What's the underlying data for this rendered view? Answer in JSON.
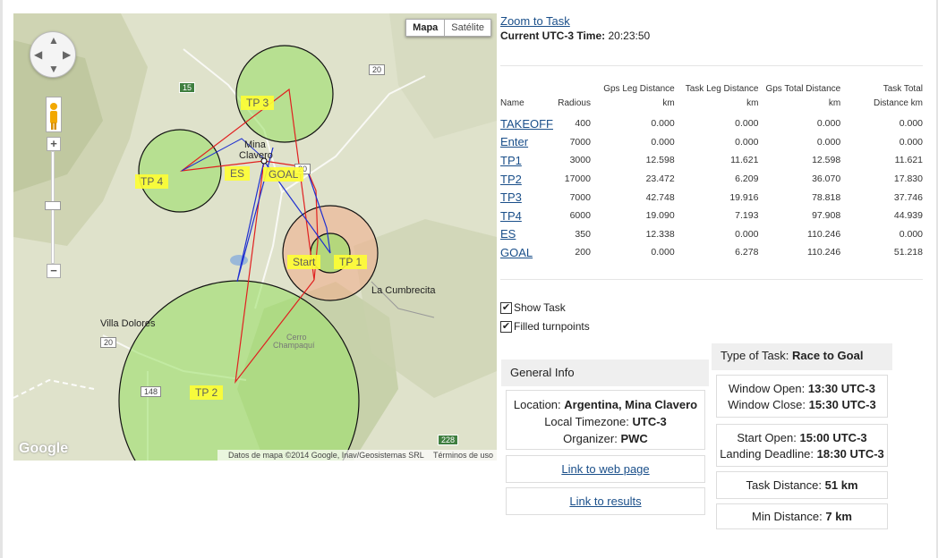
{
  "map": {
    "maptype": {
      "map_label": "Mapa",
      "satellite_label": "Satélite"
    },
    "attribution": "Datos de mapa ©2014 Google, Inav/Geosistemas SRL",
    "terms": "Términos de uso",
    "logo": "Google",
    "places": {
      "mina": "Mina",
      "clavero": "Clavero",
      "cumbrecita": "La Cumbrecita",
      "villa_dolores": "Villa Dolores",
      "cerro": "Cerro",
      "champaqui": "Champaquí"
    },
    "routes": {
      "r15": "15",
      "r20a": "20",
      "r20b": "20",
      "r148": "148",
      "r228": "228",
      "r20c": "20"
    },
    "waypoints": {
      "tp3": "TP 3",
      "tp4": "TP 4",
      "es": "ES",
      "goal": "GOAL",
      "start": "Start",
      "tp1": "TP 1",
      "tp2": "TP 2"
    },
    "icons": {
      "pan": "pan-control-icon",
      "pegman": "pegman-icon"
    }
  },
  "header": {
    "zoom_link": "Zoom to Task",
    "time_label": "Current UTC-3 Time:",
    "time_value": "20:23:50"
  },
  "table": {
    "headers": {
      "name": "Name",
      "radius": "Radious",
      "gps_leg": "Gps Leg Distance",
      "task_leg": "Task Leg Distance",
      "gps_total": "Gps Total Distance",
      "task_total": "Task Total",
      "unit": "km",
      "task_total_unit": "Distance km"
    },
    "rows": [
      {
        "name": "TAKEOFF",
        "radius": "400",
        "gps_leg": "0.000",
        "task_leg": "0.000",
        "gps_total": "0.000",
        "task_total": "0.000"
      },
      {
        "name": "Enter",
        "radius": "7000",
        "gps_leg": "0.000",
        "task_leg": "0.000",
        "gps_total": "0.000",
        "task_total": "0.000"
      },
      {
        "name": "TP1",
        "radius": "3000",
        "gps_leg": "12.598",
        "task_leg": "11.621",
        "gps_total": "12.598",
        "task_total": "11.621"
      },
      {
        "name": "TP2",
        "radius": "17000",
        "gps_leg": "23.472",
        "task_leg": "6.209",
        "gps_total": "36.070",
        "task_total": "17.830"
      },
      {
        "name": "TP3",
        "radius": "7000",
        "gps_leg": "42.748",
        "task_leg": "19.916",
        "gps_total": "78.818",
        "task_total": "37.746"
      },
      {
        "name": "TP4",
        "radius": "6000",
        "gps_leg": "19.090",
        "task_leg": "7.193",
        "gps_total": "97.908",
        "task_total": "44.939"
      },
      {
        "name": "ES",
        "radius": "350",
        "gps_leg": "12.338",
        "task_leg": "0.000",
        "gps_total": "110.246",
        "task_total": "0.000"
      },
      {
        "name": "GOAL",
        "radius": "200",
        "gps_leg": "0.000",
        "task_leg": "6.278",
        "gps_total": "110.246",
        "task_total": "51.218"
      }
    ]
  },
  "options": {
    "show_task": "Show Task",
    "filled_turnpoints": "Filled turnpoints",
    "check_mark": "✔"
  },
  "general_info": {
    "title": "General Info",
    "location_label": "Location:",
    "location_value": "Argentina, Mina Clavero",
    "timezone_label": "Local Timezone:",
    "timezone_value": "UTC-3",
    "organizer_label": "Organizer:",
    "organizer_value": "PWC",
    "link_web": "Link to web page",
    "link_results": "Link to results"
  },
  "task_info": {
    "type_label": "Type of Task:",
    "type_value": "Race to Goal",
    "window_open_label": "Window Open:",
    "window_open_value": "13:30 UTC-3",
    "window_close_label": "Window Close:",
    "window_close_value": "15:30 UTC-3",
    "start_open_label": "Start Open:",
    "start_open_value": "15:00 UTC-3",
    "landing_label": "Landing Deadline:",
    "landing_value": "18:30 UTC-3",
    "task_distance_label": "Task Distance:",
    "task_distance_value": "51 km",
    "min_distance_label": "Min Distance:",
    "min_distance_value": "7 km"
  },
  "colors": {
    "link": "#1a4f8a",
    "green_fill": "#9de06a",
    "orange_fill": "#f0b090",
    "label_yellow": "#ffff33"
  }
}
